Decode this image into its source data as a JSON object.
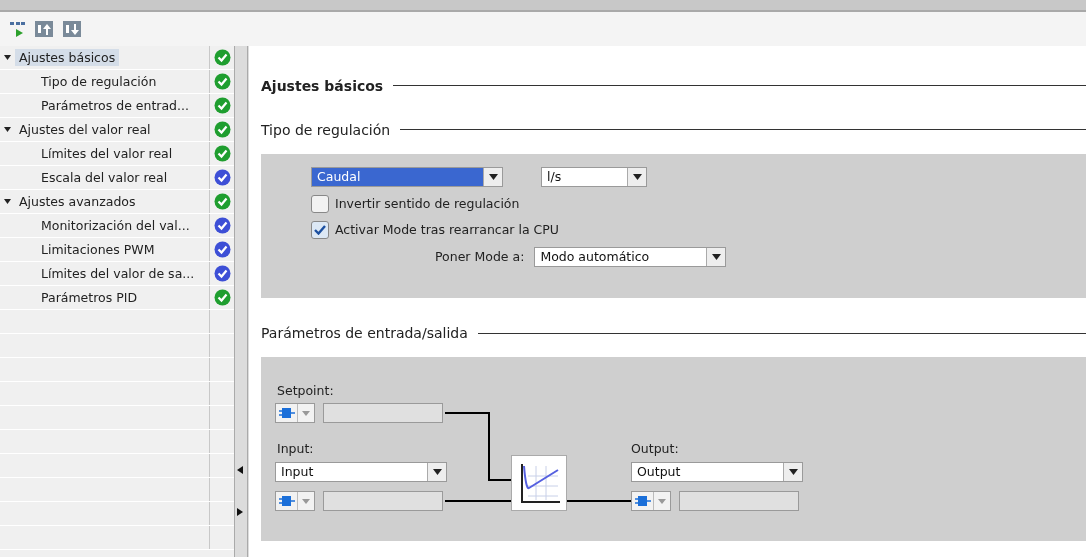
{
  "tree": [
    {
      "label": "Ajustes básicos",
      "selected": true,
      "expanded": true,
      "color": "#1f9e2f",
      "children": [
        {
          "label": "Tipo de regulación",
          "selected": false,
          "color": "#1f9e2f"
        },
        {
          "label": "Parámetros de entrad...",
          "selected": false,
          "color": "#1f9e2f"
        }
      ]
    },
    {
      "label": "Ajustes del valor real",
      "selected": false,
      "expanded": true,
      "color": "#1f9e2f",
      "children": [
        {
          "label": "Límites del valor real",
          "selected": false,
          "color": "#1f9e2f"
        },
        {
          "label": "Escala del valor real",
          "selected": false,
          "color": "#3d4fd6"
        }
      ]
    },
    {
      "label": "Ajustes avanzados",
      "selected": false,
      "expanded": true,
      "color": "#1f9e2f",
      "children": [
        {
          "label": "Monitorización del val...",
          "selected": false,
          "color": "#3d4fd6"
        },
        {
          "label": "Limitaciones PWM",
          "selected": false,
          "color": "#3d4fd6"
        },
        {
          "label": "Límites del valor de sa...",
          "selected": false,
          "color": "#3d4fd6"
        },
        {
          "label": "Parámetros PID",
          "selected": false,
          "color": "#1f9e2f"
        }
      ]
    }
  ],
  "sections": [
    {
      "title": "Ajustes básicos"
    },
    {
      "title": "Tipo de regulación"
    }
  ],
  "regulation": {
    "type": "Caudal",
    "unit": "l/s",
    "invert": {
      "label": "Invertir sentido de regulación",
      "checked": false
    },
    "activate": {
      "label": "Activar Mode tras rearrancar la CPU",
      "checked": true
    },
    "mode_label": "Poner Mode a:",
    "mode": "Modo automático"
  },
  "io_title": "Parámetros de entrada/salida",
  "io": {
    "setpoint_label": "Setpoint:",
    "input_label": "Input:",
    "input": "Input",
    "output_label": "Output:",
    "output": "Output"
  }
}
